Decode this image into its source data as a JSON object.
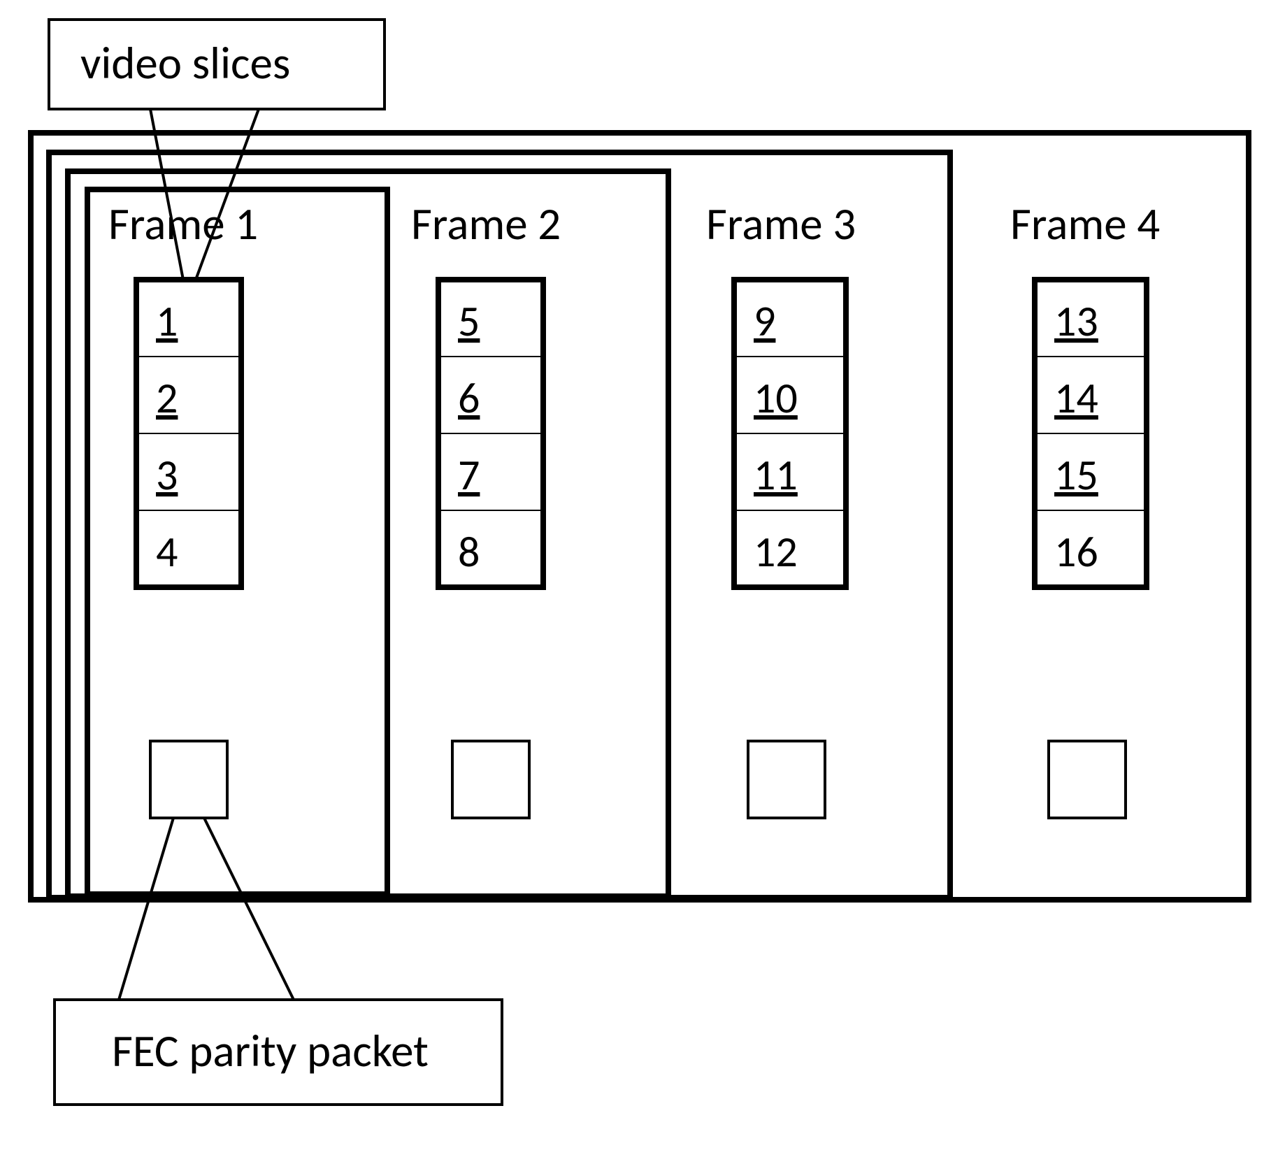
{
  "labels": {
    "video_slices": "video    slices",
    "fec_parity": "FEC parity packet"
  },
  "frames": [
    {
      "title": "Frame 1",
      "slices": [
        "1",
        "2",
        "3",
        "4"
      ]
    },
    {
      "title": "Frame 2",
      "slices": [
        "5",
        "6",
        "7",
        "8"
      ]
    },
    {
      "title": "Frame 3",
      "slices": [
        "9",
        "10",
        "11",
        "12"
      ]
    },
    {
      "title": "Frame 4",
      "slices": [
        "13",
        "14",
        "15",
        "16"
      ]
    }
  ],
  "chart_data": {
    "type": "table",
    "title": "Video slice numbering across frames with one FEC parity packet per frame",
    "frames": 4,
    "slices_per_frame": 4,
    "slice_indices": {
      "Frame 1": [
        1,
        2,
        3,
        4
      ],
      "Frame 2": [
        5,
        6,
        7,
        8
      ],
      "Frame 3": [
        9,
        10,
        11,
        12
      ],
      "Frame 4": [
        13,
        14,
        15,
        16
      ]
    },
    "fec_parity_packets_per_frame": 1,
    "annotations": [
      "video slices",
      "FEC parity packet"
    ]
  }
}
